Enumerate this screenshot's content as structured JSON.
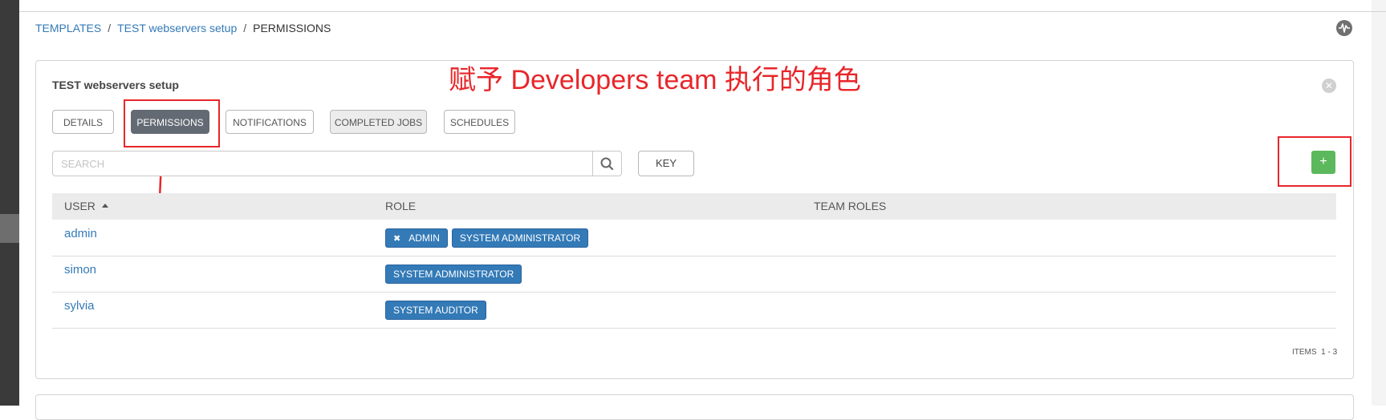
{
  "breadcrumb": {
    "items": [
      "TEMPLATES",
      "TEST webservers setup"
    ],
    "current": "PERMISSIONS",
    "separator": "/"
  },
  "panel": {
    "title": "TEST webservers setup",
    "close_icon": "close-icon"
  },
  "annotation": {
    "text": "赋予 Developers team 执行的角色",
    "color": "#e8262a"
  },
  "tabs": [
    {
      "label": "DETAILS",
      "active": false
    },
    {
      "label": "PERMISSIONS",
      "active": true
    },
    {
      "label": "NOTIFICATIONS",
      "active": false
    },
    {
      "label": "COMPLETED JOBS",
      "active": false
    },
    {
      "label": "SCHEDULES",
      "active": false
    }
  ],
  "search": {
    "placeholder": "SEARCH",
    "value": ""
  },
  "key_button": "KEY",
  "add_button": "+",
  "table": {
    "columns": [
      "USER",
      "ROLE",
      "TEAM ROLES"
    ],
    "sorted_column": "USER",
    "rows": [
      {
        "user": "admin",
        "roles": [
          {
            "label": "ADMIN",
            "removable": true
          },
          {
            "label": "SYSTEM ADMINISTRATOR"
          }
        ]
      },
      {
        "user": "simon",
        "roles": [
          {
            "label": "SYSTEM ADMINISTRATOR"
          }
        ]
      },
      {
        "user": "sylvia",
        "roles": [
          {
            "label": "SYSTEM AUDITOR"
          }
        ]
      }
    ]
  },
  "pagination": {
    "label": "ITEMS",
    "range": "1 - 3"
  },
  "colors": {
    "accent": "#337ab7",
    "add": "#5cb85c",
    "active_tab": "#646a73",
    "highlight": "#e8262a"
  }
}
